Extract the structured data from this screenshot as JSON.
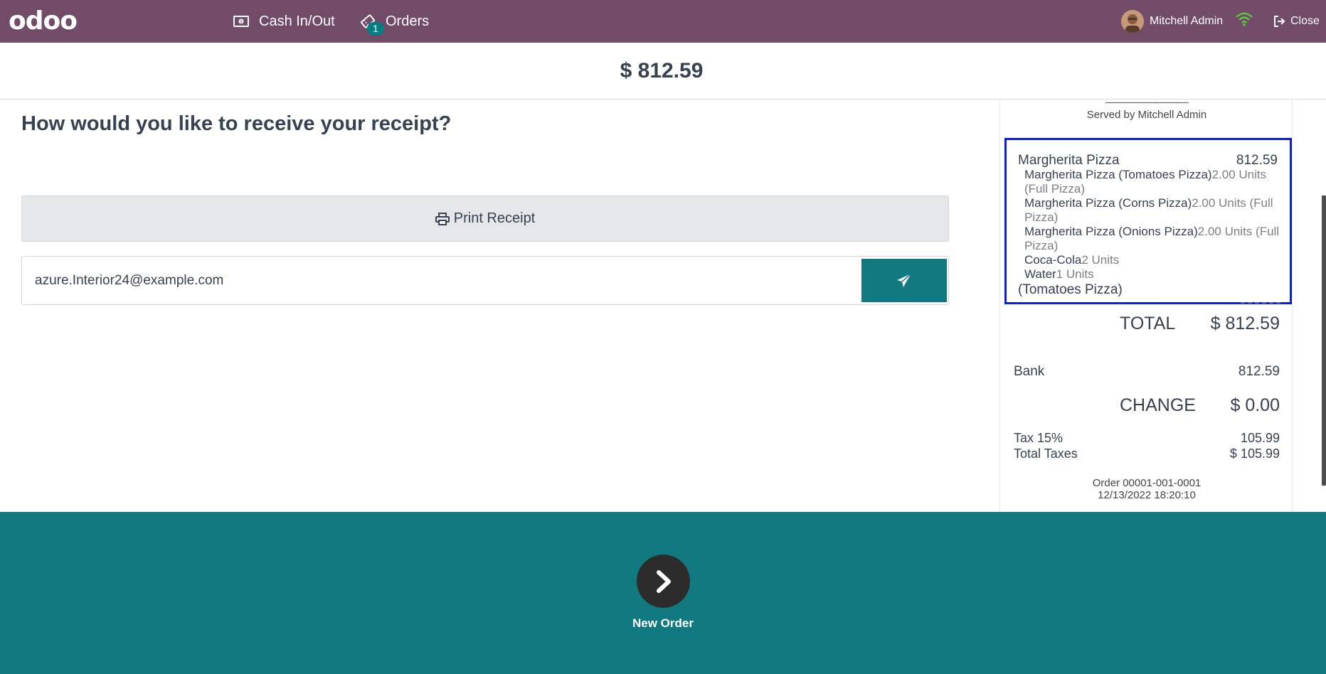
{
  "header": {
    "logo": "odoo",
    "nav": {
      "cash_label": "Cash In/Out",
      "orders_label": "Orders",
      "orders_badge": "1"
    },
    "user_name": "Mitchell Admin",
    "close_label": "Close",
    "icons": [
      "cash-icon",
      "ticket-icon",
      "wifi-icon",
      "sign-out-icon"
    ]
  },
  "amount": "$ 812.59",
  "receipt_options": {
    "question": "How would you like to receive your receipt?",
    "print_label": "Print Receipt",
    "email_value": "azure.Interior24@example.com"
  },
  "receipt": {
    "dashes": "--------------------------------",
    "served_by": "Served by Mitchell Admin",
    "lines": {
      "main_name": "Margherita Pizza",
      "main_price": "812.59",
      "sub1_name": "Margherita Pizza (Tomatoes Pizza)",
      "sub1_qty": "2.00 Units (Full Pizza)",
      "sub2_name": "Margherita Pizza (Corns Pizza)",
      "sub2_qty": "2.00 Units (Full Pizza)",
      "sub3_name": "Margherita Pizza (Onions Pizza)",
      "sub3_qty": "2.00 Units (Full Pizza)",
      "sub4_name": "Coca-Cola",
      "sub4_qty": "2 Units",
      "sub5_name": "Water",
      "sub5_qty": "1 Units",
      "note": "(Tomatoes Pizza)"
    },
    "total_label": "TOTAL",
    "total_value": "$ 812.59",
    "bank_label": "Bank",
    "bank_value": "812.59",
    "change_label": "CHANGE",
    "change_value": "$ 0.00",
    "tax_label": "Tax 15%",
    "tax_value": "105.99",
    "total_taxes_label": "Total Taxes",
    "total_taxes_value": "$ 105.99",
    "order_ref": "Order 00001-001-0001",
    "order_date": "12/13/2022 18:20:10"
  },
  "footer": {
    "new_order_label": "New Order"
  },
  "colors": {
    "topbar": "#714b67",
    "accent": "#117a80",
    "badge": "#017e84",
    "selection_border": "#0b1ed6"
  }
}
